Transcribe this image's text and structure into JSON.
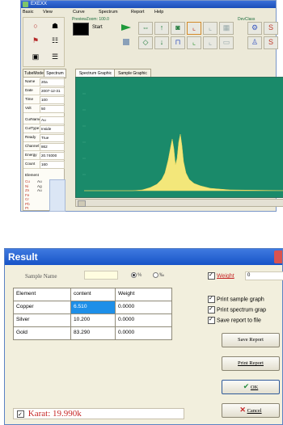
{
  "main_window": {
    "title": "EXEXX",
    "menu": [
      "Basic",
      "View",
      "Curve",
      "Spectrum",
      "Report",
      "Help"
    ],
    "preview_label": "PreviewZoom: 100.0",
    "device_label": "DevClass",
    "start_label": "Start",
    "info_tabs": [
      "TubeMode",
      "Spectrum"
    ],
    "info_rows": [
      {
        "key": "Name",
        "value": "20a"
      },
      {
        "key": "Date",
        "value": "2007-12-31"
      },
      {
        "key": "Time",
        "value": "100"
      },
      {
        "key": "Volt",
        "value": "50"
      },
      {
        "key": "CurName",
        "value": "Au"
      },
      {
        "key": "CurType",
        "value": "Inside"
      },
      {
        "key": "Ready",
        "value": "True"
      },
      {
        "key": "Channel",
        "value": "862"
      },
      {
        "key": "Energy",
        "value": "20.74000"
      },
      {
        "key": "Count",
        "value": "160"
      }
    ],
    "element_header": "Element",
    "element_list": [
      {
        "name": "Cu",
        "sym": "Au"
      },
      {
        "name": "Ni",
        "sym": "Ag"
      },
      {
        "name": "Zn",
        "sym": "Au"
      },
      {
        "name": "Fe",
        "sym": ""
      },
      {
        "name": "Cr",
        "sym": ""
      },
      {
        "name": "Pb",
        "sym": ""
      },
      {
        "name": "Pt",
        "sym": ""
      }
    ],
    "spectrum_tabs": [
      "Spectrum Graphic",
      "Sample Graphic"
    ],
    "colors": {
      "spectrum_bg": "#1a8a6a",
      "spectrum_fill": "#f3e77a"
    }
  },
  "result_dialog": {
    "title": "Result",
    "sample_name_label": "Sample Name",
    "sample_name_value": "",
    "unit_options": [
      {
        "label": "%",
        "selected": true
      },
      {
        "label": "‰",
        "selected": false
      }
    ],
    "table": {
      "headers": [
        "Element",
        "content",
        "Weight"
      ],
      "rows": [
        [
          "Copper",
          "6.510",
          "0.0000"
        ],
        [
          "Silver",
          "10.200",
          "0.0000"
        ],
        [
          "Gold",
          "83.290",
          "0.0000"
        ]
      ]
    },
    "weight_label": "Weight",
    "weight_value": "0",
    "print_sample_label": "Print sample graph",
    "print_spectrum_label": "Print spectrum grap",
    "save_report_file_label": "Save report to file",
    "save_report_button": "Save Report",
    "print_report_button": "Print Report",
    "ok_button": "OK",
    "cancel_button": "Cancel",
    "karat_label": "Karat",
    "karat_value": "19.990k",
    "colors": {
      "accent": "#1e8fe8",
      "karat_text": "#c62828",
      "title_bar": "#1753c7"
    }
  }
}
